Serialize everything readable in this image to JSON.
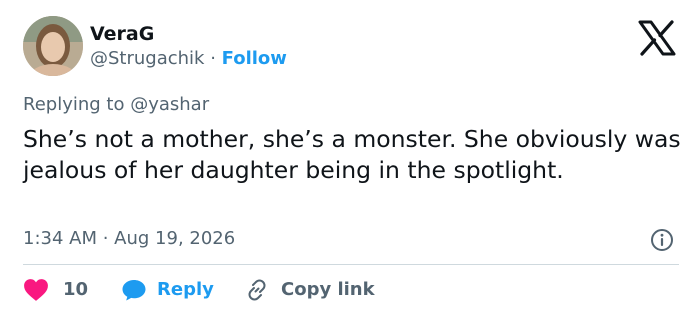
{
  "author": {
    "name": "VeraG",
    "handle": "@Strugachik",
    "separator": " · ",
    "follow_label": "Follow"
  },
  "reply_context": {
    "text": "Replying to @yashar"
  },
  "tweet": {
    "text": "She’s not a mother, she’s a monster. She obviously was jealous of her daughter being in the spotlight.",
    "time": "1:34 AM",
    "date_separator": " · ",
    "date": "Aug 19, 2026"
  },
  "actions": {
    "like_count": "10",
    "reply_label": "Reply",
    "copy_label": "Copy link"
  },
  "icons": {
    "logo": "x-logo-icon",
    "info": "info-icon",
    "like": "heart-icon",
    "reply": "speech-bubble-icon",
    "copy": "link-icon"
  },
  "colors": {
    "accent": "#1d9bf0",
    "heart": "#f91880",
    "secondary_text": "#536471",
    "primary_text": "#0f1419"
  }
}
